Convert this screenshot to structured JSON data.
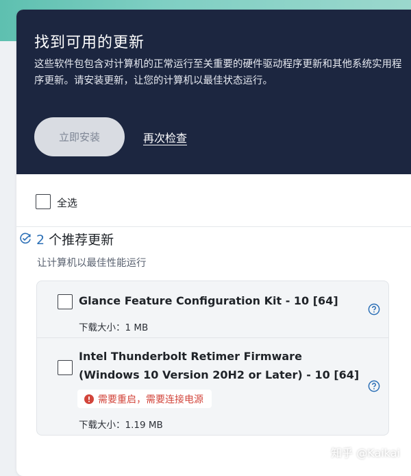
{
  "hero": {
    "title": "找到可用的更新",
    "description": "这些软件包包含对计算机的正常运行至关重要的硬件驱动程序更新和其他系统实用程序更新。请安装更新，让您的计算机以最佳状态运行。",
    "install_button": "立即安装",
    "recheck_link": "再次检查"
  },
  "select_all": {
    "label": "全选"
  },
  "section": {
    "icon": "refresh-check-icon",
    "count": "2",
    "title_suffix": " 个推荐更新",
    "subtitle": "让计算机以最佳性能运行"
  },
  "updates": [
    {
      "name": "Glance Feature Configuration Kit - 10 [64]",
      "size": "下载大小：1 MB"
    },
    {
      "name": "Intel Thunderbolt Retimer Firmware (Windows 10 Version 20H2 or Later) - 10 [64]",
      "warning": "需要重启，需要连接电源",
      "size": "下载大小：1.19 MB"
    }
  ],
  "watermark": "知乎 @Kaikai",
  "colors": {
    "hero_bg": "#1c2640",
    "accent_blue": "#2b6fb6",
    "warning_red": "#d2453b",
    "teal_bg": "#5ec0b0"
  }
}
